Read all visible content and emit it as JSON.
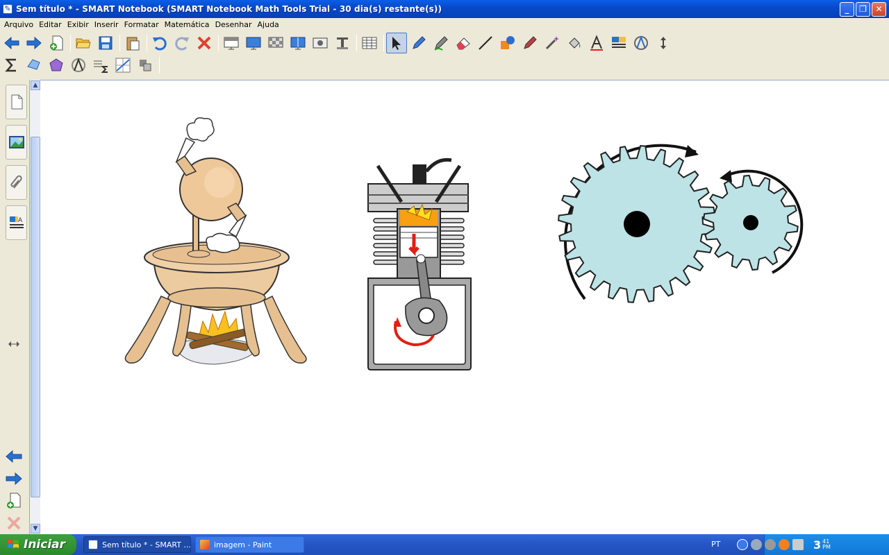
{
  "window": {
    "title": "Sem título * - SMART Notebook (SMART Notebook Math Tools Trial - 30 dia(s) restante(s))",
    "app_icon": "smart-notebook-icon"
  },
  "menu": [
    "Arquivo",
    "Editar",
    "Exibir",
    "Inserir",
    "Formatar",
    "Matemática",
    "Desenhar",
    "Ajuda"
  ],
  "toolbar1_icons": [
    "back-icon",
    "forward-icon",
    "add-page-icon",
    "open-icon",
    "save-icon",
    "paste-icon",
    "undo-icon",
    "redo-icon",
    "delete-icon",
    "screen-shade-icon",
    "full-screen-icon",
    "transparent-bg-icon",
    "dual-display-icon",
    "screen-capture-icon",
    "document-camera-icon",
    "table-icon",
    "select-icon",
    "pen-icon",
    "creative-pen-icon",
    "eraser-icon",
    "line-icon",
    "shape-icon",
    "shape-recognition-pen-icon",
    "magic-pen-icon",
    "fill-icon",
    "text-icon",
    "properties-icon",
    "measurement-icon",
    "move-toolbar-icon"
  ],
  "toolbar2_icons": [
    "sigma-icon",
    "shape-tool-icon",
    "polygon-icon",
    "measurement-tools-icon",
    "table-sigma-icon",
    "graph-icon",
    "tools-icon"
  ],
  "taskbar": {
    "start_label": "Iniciar",
    "tasks": [
      {
        "label": "Sem título * - SMART ...",
        "active": false
      },
      {
        "label": "imagem - Paint",
        "active": true
      }
    ],
    "language": "PT",
    "clock_hour": "3",
    "clock_minutes": "41",
    "clock_ampm": "PM"
  },
  "colors": {
    "title_bar": "#0a5fe6",
    "taskbar": "#2455c5",
    "start_button": "#3da03d",
    "gear_fill": "#bde3e6",
    "tray": "#1278d8"
  }
}
